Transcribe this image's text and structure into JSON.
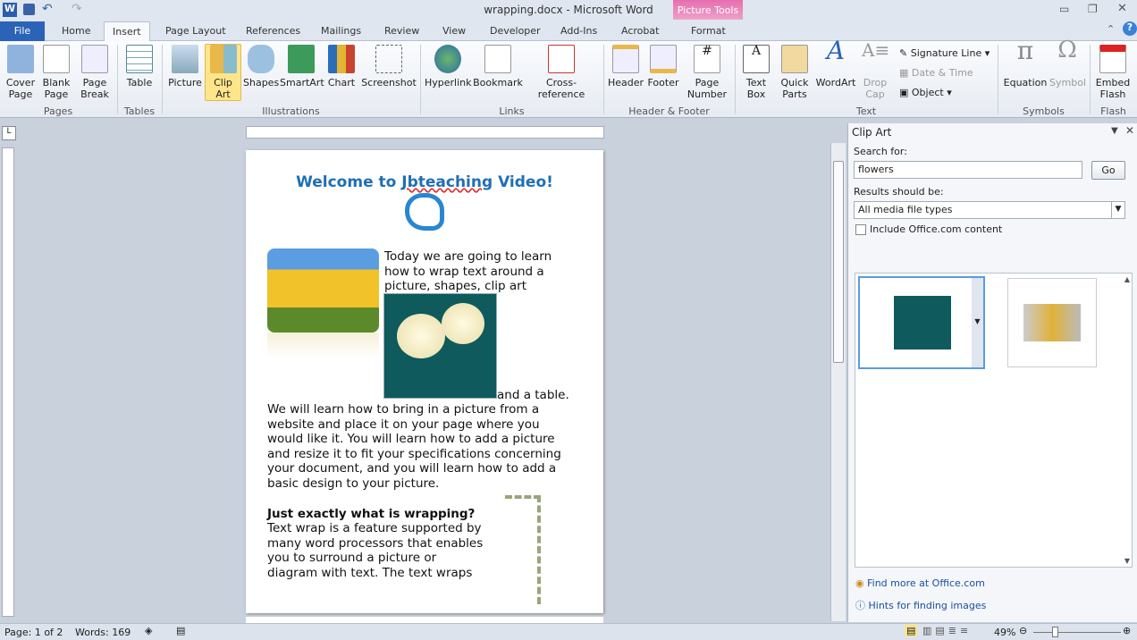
{
  "window": {
    "title": "wrapping.docx - Microsoft Word"
  },
  "tabs": [
    "File",
    "Home",
    "Insert",
    "Page Layout",
    "References",
    "Mailings",
    "Review",
    "View",
    "Developer",
    "Add-Ins",
    "Acrobat",
    "Format"
  ],
  "contextual_tab": "Picture Tools",
  "ribbon": {
    "groups": [
      "Pages",
      "Tables",
      "Illustrations",
      "Links",
      "Header & Footer",
      "Text",
      "Symbols",
      "Flash"
    ],
    "buttons": {
      "cover_page": "Cover Page",
      "blank_page": "Blank Page",
      "page_break": "Page Break",
      "table": "Table",
      "picture": "Picture",
      "clip_art": "Clip Art",
      "shapes": "Shapes",
      "smartart": "SmartArt",
      "chart": "Chart",
      "screenshot": "Screenshot",
      "hyperlink": "Hyperlink",
      "bookmark": "Bookmark",
      "cross_reference": "Cross-reference",
      "header": "Header",
      "footer": "Footer",
      "page_number": "Page Number",
      "text_box": "Text Box",
      "quick_parts": "Quick Parts",
      "wordart": "WordArt",
      "drop_cap": "Drop Cap",
      "signature_line": "Signature Line",
      "date_time": "Date & Time",
      "object": "Object",
      "equation": "Equation",
      "symbol": "Symbol",
      "embed_flash": "Embed Flash"
    }
  },
  "document": {
    "title_prefix": "Welcome to ",
    "title_link": "Jbteaching",
    "title_suffix": " Video!",
    "para1_lines": [
      "Today we are going to learn",
      "how to wrap text around a",
      "picture, shapes, clip art"
    ],
    "para1_end": "and a table.",
    "para2": "We will learn how to bring in a picture from a website and place it on your page where you would like it. You will learn how to add a picture and resize it to fit your specifications concerning your document, and you will learn how to add a basic design to your picture.",
    "heading": "Just exactly what is wrapping?",
    "para3_lines": [
      "Text wrap is a feature supported by",
      "many word processors that enables",
      "you to surround a picture or",
      "diagram with text. The text wraps"
    ]
  },
  "clip_art": {
    "title": "Clip Art",
    "search_label": "Search for:",
    "search_value": "flowers",
    "go": "Go",
    "results_label": "Results should be:",
    "results_value": "All media file types",
    "include_office": "Include Office.com content",
    "include_office_checked": false,
    "find_more": "Find more at Office.com",
    "hints": "Hints for finding images"
  },
  "status": {
    "page": "Page: 1 of 2",
    "words": "Words: 169",
    "zoom": "49%",
    "zoom_level": 49
  }
}
